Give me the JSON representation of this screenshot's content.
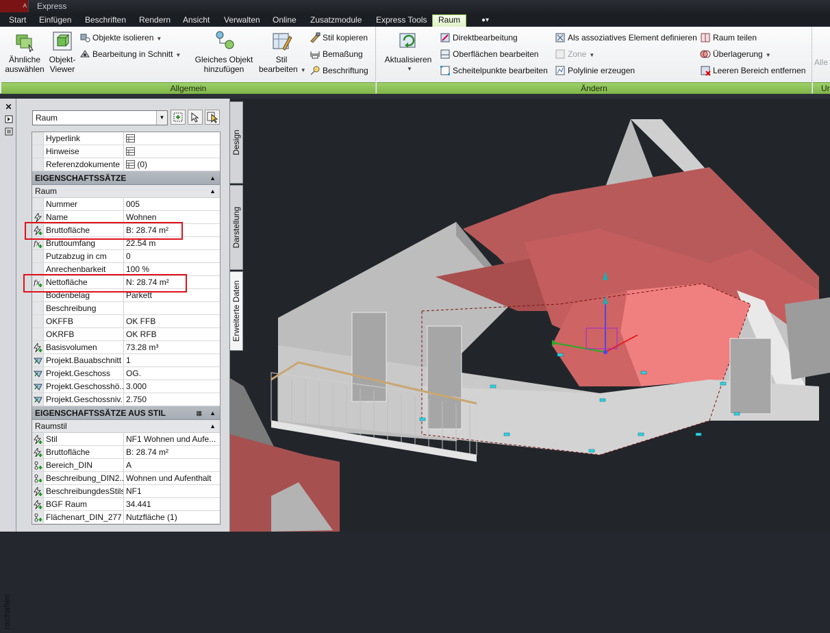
{
  "window": {
    "title": "Express",
    "logo_badge": "A"
  },
  "tabs": [
    "Start",
    "Einfügen",
    "Beschriften",
    "Rendern",
    "Ansicht",
    "Verwalten",
    "Online",
    "Zusatzmodule",
    "Express Tools",
    "Raum"
  ],
  "active_tab": "Raum",
  "ribbon": {
    "allgemein": {
      "title": "Allgemein",
      "aehnliche_line1": "Ähnliche",
      "aehnliche_line2": "auswählen",
      "objektviewer_line1": "Objekt-",
      "objektviewer_line2": "Viewer",
      "isolieren": "Objekte isolieren",
      "bearbeitung_schnitt": "Bearbeitung in Schnitt",
      "gleiches_line1": "Gleiches Objekt",
      "gleiches_line2": "hinzufügen",
      "stil_line1": "Stil",
      "stil_line2": "bearbeiten",
      "stil_kopieren": "Stil kopieren",
      "bemassung": "Bemaßung",
      "beschriftung": "Beschriftung"
    },
    "aendern": {
      "title": "Ändern",
      "aktualisieren": "Aktualisieren",
      "direktbearbeitung": "Direktbearbeitung",
      "oberflaechen": "Oberflächen bearbeiten",
      "scheitelpunkte": "Scheitelpunkte bearbeiten",
      "assoziativ": "Als assoziatives Element definieren",
      "zone": "Zone",
      "polylinie": "Polylinie erzeugen",
      "raum_teilen": "Raum teilen",
      "ueberlagerung": "Überlagerung",
      "leeren_bereich": "Leeren Bereich entfernen"
    },
    "cut_panel": {
      "title": "Ur",
      "item": "Alle"
    }
  },
  "palette": {
    "side_label": "nschaften",
    "selector": "Raum",
    "vtabs": [
      "Design",
      "Darstellung",
      "Erweiterte Daten"
    ],
    "top_rows": [
      {
        "name": "Hyperlink",
        "value": ""
      },
      {
        "name": "Hinweise",
        "value": ""
      },
      {
        "name": "Referenzdokumente",
        "value": "(0)"
      }
    ],
    "section1": "EIGENSCHAFTSSÄTZE",
    "sub1": "Raum",
    "raum_rows": [
      {
        "name": "Nummer",
        "value": "005",
        "icon": ""
      },
      {
        "name": "Name",
        "value": "Wohnen",
        "icon": "lightning"
      },
      {
        "name": "Bruttofläche",
        "value": "B: 28.74 m²",
        "icon": "lightning-plus"
      },
      {
        "name": "Bruttoumfang",
        "value": "22.54 m",
        "icon": "formula"
      },
      {
        "name": "Putzabzug in cm",
        "value": "0",
        "icon": ""
      },
      {
        "name": "Anrechenbarkeit",
        "value": "100 %",
        "icon": ""
      },
      {
        "name": "Nettofläche",
        "value": "N: 28.74 m²",
        "icon": "formula"
      },
      {
        "name": "Bodenbelag",
        "value": "Parkett",
        "icon": ""
      },
      {
        "name": "Beschreibung",
        "value": "",
        "icon": ""
      },
      {
        "name": "OKFFB",
        "value": "OK FFB",
        "icon": ""
      },
      {
        "name": "OKRFB",
        "value": "OK RFB",
        "icon": ""
      },
      {
        "name": "Basisvolumen",
        "value": "73.28 m³",
        "icon": "lightning-plus"
      },
      {
        "name": "Projekt.Bauabschnitt",
        "value": "1",
        "icon": "project"
      },
      {
        "name": "Projekt.Geschoss",
        "value": "OG.",
        "icon": "project"
      },
      {
        "name": "Projekt.Geschosshö...",
        "value": "3.000",
        "icon": "project"
      },
      {
        "name": "Projekt.Geschossniv...",
        "value": "2.750",
        "icon": "project"
      }
    ],
    "section2": "EIGENSCHAFTSSÄTZE AUS STIL",
    "sub2": "Raumstil",
    "stil_rows": [
      {
        "name": "Stil",
        "value": "NF1 Wohnen und Aufe...",
        "icon": "lightning-plus"
      },
      {
        "name": "Bruttofläche",
        "value": "B: 28.74 m²",
        "icon": "lightning-plus"
      },
      {
        "name": "Bereich_DIN",
        "value": "A",
        "icon": "node"
      },
      {
        "name": "Beschreibung_DIN2...",
        "value": "Wohnen und Aufenthalt",
        "icon": "node"
      },
      {
        "name": "BeschreibungdesStils",
        "value": "NF1",
        "icon": "lightning-plus"
      },
      {
        "name": "BGF Raum",
        "value": "34.441",
        "icon": "lightning-plus"
      },
      {
        "name": "Flächenart_DIN_277",
        "value": "Nutzfläche (1)",
        "icon": "node"
      }
    ]
  },
  "colors": {
    "accent_green": "#86c14a",
    "highlight_red": "#e0101a",
    "roof_red": "#b85c5c",
    "room_pink": "#f08080",
    "viewport_bg": "#22262b"
  }
}
